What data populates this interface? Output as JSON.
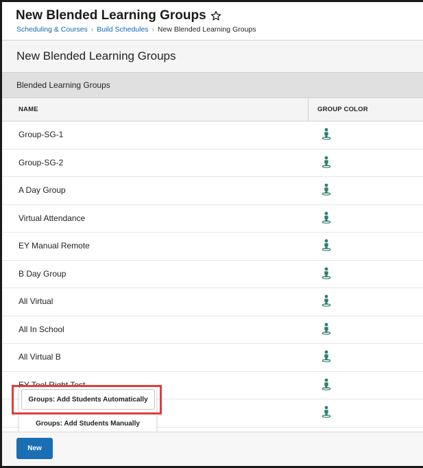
{
  "header": {
    "title": "New Blended Learning Groups",
    "breadcrumb": [
      "Scheduling & Courses",
      "Build Schedules",
      "New Blended Learning Groups"
    ]
  },
  "section": {
    "title": "New Blended Learning Groups",
    "group_header": "Blended Learning Groups"
  },
  "table": {
    "columns": [
      "NAME",
      "GROUP COLOR"
    ],
    "rows": [
      {
        "name": "Group-SG-1"
      },
      {
        "name": "Group-SG-2"
      },
      {
        "name": "A Day Group"
      },
      {
        "name": "Virtual Attendance"
      },
      {
        "name": "EY Manual Remote"
      },
      {
        "name": "B Day Group"
      },
      {
        "name": "All Virtual"
      },
      {
        "name": "All In School"
      },
      {
        "name": "All Virtual B"
      },
      {
        "name": "EY Tool Right Test"
      },
      {
        "name": ""
      }
    ],
    "icon": "person-icon",
    "icon_color": "#2e7d6e"
  },
  "popup_menu": {
    "items": [
      "Groups: Add Students Automatically",
      "Groups: Add Students Manually"
    ]
  },
  "footer": {
    "new_label": "New"
  },
  "colors": {
    "accent": "#1a6fb4",
    "link": "#1466b3",
    "highlight": "#e23b3b"
  }
}
